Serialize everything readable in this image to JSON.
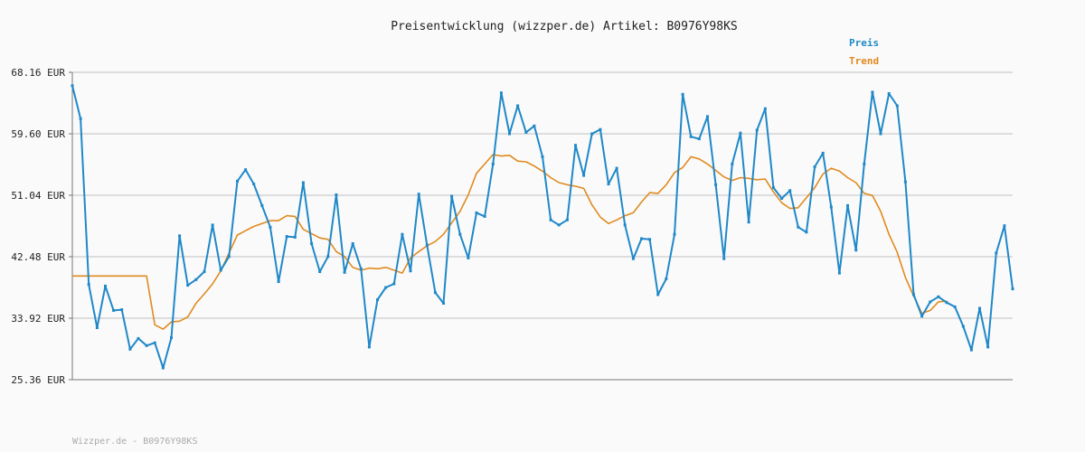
{
  "chart_data": {
    "type": "line",
    "title": "Preisentwicklung (wizzper.de) Artikel: B0976Y98KS",
    "xlabel": "",
    "ylabel": "",
    "ylim": [
      25.36,
      68.16
    ],
    "y_ticks": [
      "68.16 EUR",
      "59.60 EUR",
      "51.04 EUR",
      "42.48 EUR",
      "33.92 EUR",
      "25.36 EUR"
    ],
    "y_tick_values": [
      68.16,
      59.6,
      51.04,
      42.48,
      33.92,
      25.36
    ],
    "grid": true,
    "legend_position": "top-right",
    "colors": {
      "preis": "#1f88c8",
      "trend": "#e08a20",
      "grid": "#dddddd",
      "axis": "#777777"
    },
    "series": [
      {
        "name": "Preis",
        "values": [
          66.3,
          61.7,
          38.6,
          32.6,
          38.4,
          35.0,
          35.1,
          29.6,
          31.1,
          30.1,
          30.5,
          27.0,
          31.2,
          45.4,
          38.5,
          39.3,
          40.4,
          46.9,
          40.6,
          42.5,
          53.0,
          54.6,
          52.6,
          49.6,
          46.6,
          39.0,
          45.3,
          45.2,
          52.8,
          44.3,
          40.4,
          42.5,
          51.1,
          40.3,
          44.3,
          40.8,
          29.9,
          36.5,
          38.2,
          38.7,
          45.6,
          40.5,
          51.2,
          44.1,
          37.5,
          36.0,
          50.9,
          45.6,
          42.3,
          48.6,
          48.1,
          55.4,
          65.3,
          59.6,
          63.5,
          59.8,
          60.7,
          56.4,
          47.6,
          46.9,
          47.6,
          58.0,
          53.8,
          59.6,
          60.2,
          52.6,
          54.8,
          46.9,
          42.2,
          45.0,
          44.9,
          37.2,
          39.4,
          45.6,
          65.1,
          59.2,
          58.9,
          62.0,
          52.5,
          42.2,
          55.4,
          59.7,
          47.3,
          60.1,
          63.1,
          52.1,
          50.6,
          51.7,
          46.6,
          45.9,
          55.0,
          56.9,
          49.4,
          40.2,
          49.6,
          43.4,
          55.4,
          65.4,
          59.6,
          65.2,
          63.5,
          52.9,
          37.2,
          34.2,
          36.2,
          36.9,
          36.1,
          35.5,
          32.8,
          29.5,
          35.3,
          29.9,
          43.0,
          46.8,
          38.0
        ]
      },
      {
        "name": "Trend",
        "values": [
          39.8,
          39.8,
          39.8,
          39.8,
          39.8,
          39.8,
          39.8,
          39.8,
          39.8,
          39.8,
          33.0,
          32.4,
          33.4,
          33.5,
          34.1,
          36.0,
          37.3,
          38.7,
          40.5,
          43.0,
          45.5,
          46.1,
          46.7,
          47.1,
          47.5,
          47.5,
          48.2,
          48.1,
          46.3,
          45.7,
          45.1,
          44.9,
          43.2,
          42.5,
          41.0,
          40.6,
          40.9,
          40.8,
          41.0,
          40.6,
          40.2,
          42.3,
          43.2,
          44.0,
          44.6,
          45.6,
          47.2,
          48.8,
          51.1,
          54.1,
          55.4,
          56.7,
          56.5,
          56.6,
          55.8,
          55.7,
          55.1,
          54.4,
          53.5,
          52.8,
          52.5,
          52.3,
          52.0,
          49.7,
          48.0,
          47.1,
          47.6,
          48.2,
          48.6,
          50.1,
          51.4,
          51.3,
          52.5,
          54.2,
          54.9,
          56.4,
          56.1,
          55.4,
          54.5,
          53.6,
          53.1,
          53.5,
          53.4,
          53.2,
          53.3,
          51.5,
          50.0,
          49.2,
          49.3,
          50.7,
          52.1,
          54.0,
          54.8,
          54.4,
          53.5,
          52.8,
          51.3,
          51.0,
          48.8,
          45.6,
          43.1,
          39.6,
          37.0,
          34.6,
          35.0,
          36.2,
          36.3
        ]
      }
    ]
  },
  "footer_text": "Wizzper.de - B0976Y98KS"
}
